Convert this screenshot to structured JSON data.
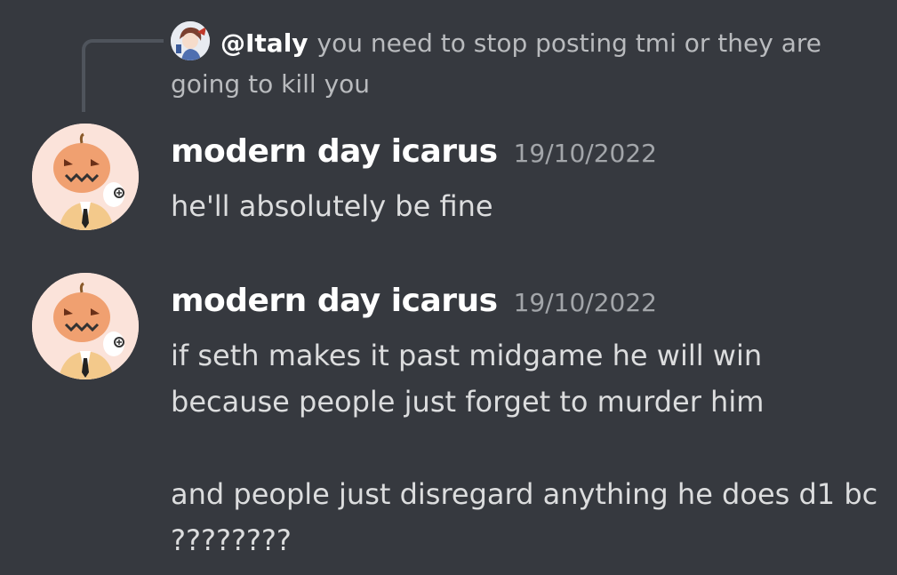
{
  "reply": {
    "author": "@Italy",
    "text": "you need to stop posting tmi or they are going to kill you",
    "avatar_icon": "anime-character-avatar-icon"
  },
  "messages": [
    {
      "author": "modern day icarus",
      "timestamp": "19/10/2022",
      "content": "he'll absolutely be fine",
      "avatar_icon": "pumpkin-head-avatar-icon"
    },
    {
      "author": "modern day icarus",
      "timestamp": "19/10/2022",
      "content": "if seth makes it past midgame he will win because people just forget to murder him\n\nand people just disregard anything he does d1 bc ????????",
      "avatar_icon": "pumpkin-head-avatar-icon"
    }
  ],
  "colors": {
    "background": "#36393f",
    "username": "#ffffff",
    "text": "#dcddde",
    "muted": "#a3a6aa",
    "reply_line": "#4f545c"
  }
}
